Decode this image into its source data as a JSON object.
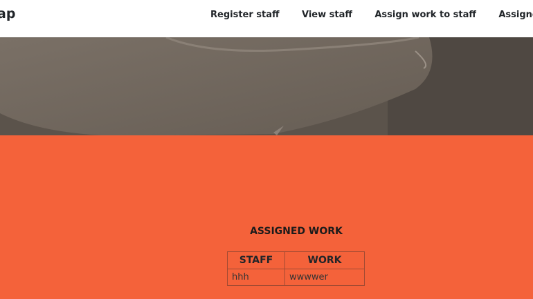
{
  "brand": {
    "text": "ap"
  },
  "nav": {
    "links": [
      "Register staff",
      "View staff",
      "Assign work to staff",
      "Assigned work"
    ]
  },
  "section": {
    "title": "ASSIGNED WORK",
    "table": {
      "headers": [
        "STAFF",
        "WORK"
      ],
      "rows": [
        [
          "hhh",
          "wwwwer"
        ]
      ]
    }
  },
  "colors": {
    "accent": "#f4623a",
    "navbar_bg": "#ffffff",
    "text_dark": "#212529"
  }
}
